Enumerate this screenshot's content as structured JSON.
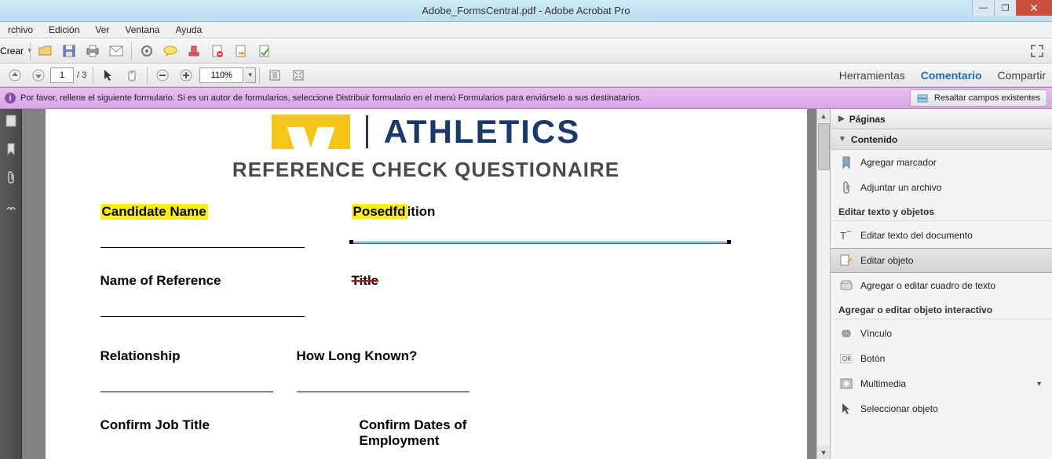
{
  "window": {
    "title": "Adobe_FormsCentral.pdf - Adobe Acrobat Pro"
  },
  "menu": {
    "items": [
      "rchivo",
      "Edición",
      "Ver",
      "Ventana",
      "Ayuda"
    ]
  },
  "toolbar1": {
    "crear": "Crear"
  },
  "toolbar2": {
    "page_current": "1",
    "page_total": "/ 3",
    "zoom": "110%",
    "links": {
      "herramientas": "Herramientas",
      "comentario": "Comentario",
      "compartir": "Compartir"
    }
  },
  "notice": {
    "text": "Por favor, rellene el siguiente formulario. Si es un autor de formularios, seleccione Distribuir formulario en el menú Formularios para enviárselo a sus destinatarios.",
    "button": "Resaltar campos existentes"
  },
  "document": {
    "logo_text": "ATHLETICS",
    "title": "REFERENCE CHECK QUESTIONAIRE",
    "fields": {
      "candidate_name": "Candidate Name",
      "position_edit": "Posedfdition",
      "name_of_reference": "Name of Reference",
      "title": "Title",
      "relationship": "Relationship",
      "how_long_known": "How Long Known?",
      "confirm_job_title": "Confirm Job Title",
      "confirm_dates": "Confirm Dates of Employment"
    }
  },
  "right_panel": {
    "paginas": "Páginas",
    "contenido": "Contenido",
    "agregar_marcador": "Agregar marcador",
    "adjuntar_archivo": "Adjuntar un archivo",
    "section_editar": "Editar texto y objetos",
    "editar_texto_doc": "Editar texto del documento",
    "editar_objeto": "Editar objeto",
    "agregar_cuadro": "Agregar o editar cuadro de texto",
    "section_interactivo": "Agregar o editar objeto interactivo",
    "vinculo": "Vínculo",
    "boton": "Botón",
    "multimedia": "Multimedia",
    "seleccionar_objeto": "Seleccionar objeto"
  }
}
